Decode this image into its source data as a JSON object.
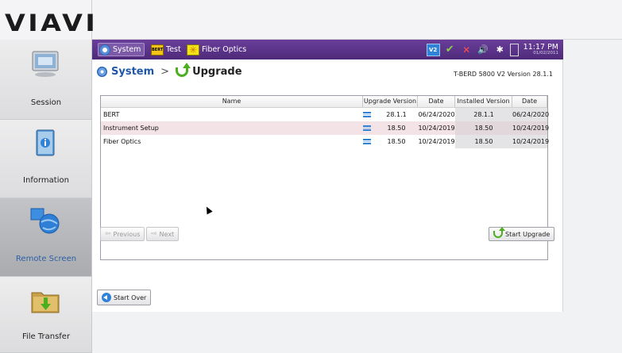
{
  "brand": {
    "logo": "VIAVI"
  },
  "nav": [
    {
      "label": "Session",
      "icon": "monitor-icon",
      "active": false
    },
    {
      "label": "Information",
      "icon": "info-book-icon",
      "active": false
    },
    {
      "label": "Remote Screen",
      "icon": "remote-globe-icon",
      "active": true
    },
    {
      "label": "File Transfer",
      "icon": "folder-download-icon",
      "active": false
    }
  ],
  "devbar": {
    "tabs": [
      {
        "label": "System",
        "icon": "gear-icon",
        "selected": true
      },
      {
        "label": "Test",
        "icon": "test-bert-icon",
        "icon_text": "BERT",
        "selected": false
      },
      {
        "label": "Fiber Optics",
        "icon": "fiber-optics-icon",
        "selected": false
      }
    ],
    "status_icons": [
      {
        "name": "vnc-icon",
        "text": "V2"
      },
      {
        "name": "connection-check-icon",
        "text": "✔"
      },
      {
        "name": "wifi-off-icon",
        "text": "✕"
      },
      {
        "name": "speaker-icon",
        "text": "🔊"
      },
      {
        "name": "bluetooth-icon",
        "text": "✱"
      },
      {
        "name": "battery-icon",
        "text": ""
      }
    ],
    "time": "11:17 PM",
    "date": "01/02/2011"
  },
  "header": {
    "crumb_system": "System",
    "crumb_sep": ">",
    "crumb_upgrade": "Upgrade",
    "version": "T-BERD 5800 V2 Version 28.1.1"
  },
  "table": {
    "columns": [
      "Name",
      "Upgrade Version",
      "Date",
      "Installed Version",
      "Date"
    ],
    "rows": [
      {
        "name": "BERT",
        "upgrade_version": "28.1.1",
        "upgrade_date": "06/24/2020",
        "installed_version": "28.1.1",
        "installed_date": "06/24/2020"
      },
      {
        "name": "Instrument Setup",
        "upgrade_version": "18.50",
        "upgrade_date": "10/24/2019",
        "installed_version": "18.50",
        "installed_date": "10/24/2019"
      },
      {
        "name": "Fiber Optics",
        "upgrade_version": "18.50",
        "upgrade_date": "10/24/2019",
        "installed_version": "18.50",
        "installed_date": "10/24/2019"
      }
    ]
  },
  "buttons": {
    "previous": "Previous",
    "next": "Next",
    "start_upgrade": "Start Upgrade",
    "start_over": "Start Over"
  },
  "colors": {
    "devbar": "#5a3388",
    "accent_blue": "#1f56a8",
    "upgrade_green": "#4caf1f",
    "row_highlight": "#f3e3e7"
  }
}
